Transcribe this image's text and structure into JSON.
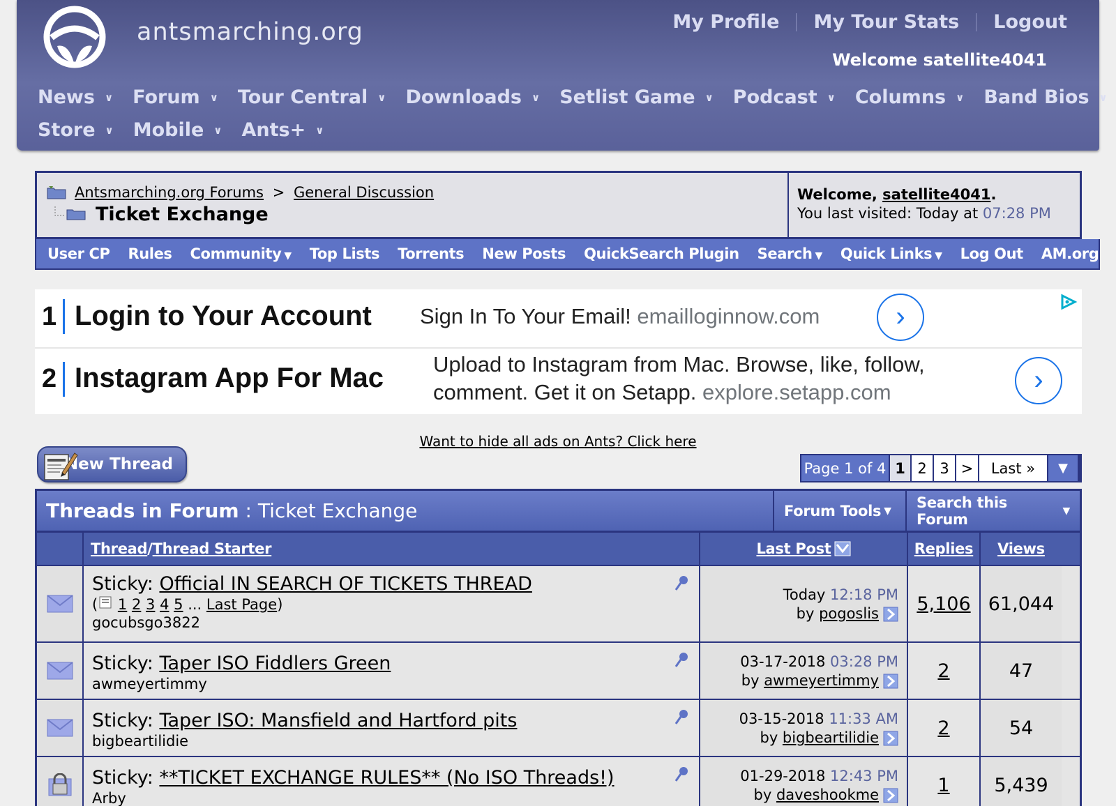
{
  "site": {
    "name": "antsmarching.org",
    "top_links": [
      "My Profile",
      "My Tour Stats",
      "Logout"
    ],
    "welcome": "Welcome satellite4041",
    "nav_row1": [
      "News",
      "Forum",
      "Tour Central",
      "Downloads",
      "Setlist Game",
      "Podcast",
      "Columns",
      "Band Bios"
    ],
    "nav_row2": [
      "Store",
      "Mobile",
      "Ants+"
    ]
  },
  "breadcrumb": {
    "forums": "Antsmarching.org Forums",
    "separator": ">",
    "section": "General Discussion",
    "title": "Ticket Exchange",
    "welcome_prefix": "Welcome, ",
    "username": "satellite4041",
    "welcome_suffix": ".",
    "last_visited_label": "You last visited: Today at ",
    "last_visited_time": "07:28 PM"
  },
  "navbar": [
    {
      "label": "User CP",
      "menu": false
    },
    {
      "label": "Rules",
      "menu": false
    },
    {
      "label": "Community",
      "menu": true
    },
    {
      "label": "Top Lists",
      "menu": false
    },
    {
      "label": "Torrents",
      "menu": false
    },
    {
      "label": "New Posts",
      "menu": false
    },
    {
      "label": "QuickSearch Plugin",
      "menu": false
    },
    {
      "label": "Search",
      "menu": true
    },
    {
      "label": "Quick Links",
      "menu": true
    },
    {
      "label": "Log Out",
      "menu": false
    },
    {
      "label": "AM.org",
      "menu": false
    }
  ],
  "ads": [
    {
      "num": "1",
      "title": "Login to Your Account",
      "desc": "Sign In To Your Email!",
      "url": "emailloginnow.com"
    },
    {
      "num": "2",
      "title": "Instagram App For Mac",
      "desc_line1": "Upload to Instagram from Mac. Browse, like, follow,",
      "desc_line2": "comment. Get it on Setapp.",
      "url": "explore.setapp.com"
    }
  ],
  "hide_ads": "Want to hide all ads on Ants? Click here",
  "new_thread": "New Thread",
  "pagination": {
    "info": "Page 1 of 4",
    "pages": [
      "1",
      "2",
      "3"
    ],
    "current": "1",
    "next": ">",
    "last": "Last »",
    "dropdown": "▼"
  },
  "table": {
    "title_bold": "Threads in Forum",
    "title_sep": " : ",
    "title_forum": "Ticket Exchange",
    "tools": [
      "Forum Tools",
      "Search this Forum"
    ],
    "col_thread": "Thread",
    "col_slash": " / ",
    "col_starter": "Thread Starter",
    "col_last": "Last Post",
    "col_replies": "Replies",
    "col_views": "Views",
    "rows": [
      {
        "prefix": "Sticky: ",
        "title": "Official IN SEARCH OF TICKETS THREAD",
        "pages": [
          "1",
          "2",
          "3",
          "4",
          "5"
        ],
        "pages_more": "...",
        "last_page": "Last Page",
        "starter": "gocubsgo3822",
        "date": "Today",
        "time": "12:18 PM",
        "by": "by ",
        "last_user": "pogoslis",
        "replies": "5,106",
        "views": "61,044",
        "icon": "envelope"
      },
      {
        "prefix": "Sticky: ",
        "title": "Taper ISO Fiddlers Green",
        "starter": "awmeyertimmy",
        "date": "03-17-2018",
        "time": "03:28 PM",
        "by": "by ",
        "last_user": "awmeyertimmy",
        "replies": "2",
        "views": "47",
        "icon": "envelope"
      },
      {
        "prefix": "Sticky: ",
        "title": "Taper ISO: Mansfield and Hartford pits",
        "starter": "bigbeartilidie",
        "date": "03-15-2018",
        "time": "11:33 AM",
        "by": "by ",
        "last_user": "bigbeartilidie",
        "replies": "2",
        "views": "54",
        "icon": "envelope"
      },
      {
        "prefix": "Sticky: ",
        "title": "**TICKET EXCHANGE RULES** (No ISO Threads!)",
        "starter": "Arby",
        "date": "01-29-2018",
        "time": "12:43 PM",
        "by": "by ",
        "last_user": "daveshookme",
        "replies": "1",
        "views": "5,439",
        "icon": "lock"
      }
    ]
  },
  "colors": {
    "header": "#5e659c",
    "navbar": "#5e73c6",
    "border": "#2b3580",
    "accent_time": "#5a649e",
    "ad_blue": "#1a73e8"
  }
}
